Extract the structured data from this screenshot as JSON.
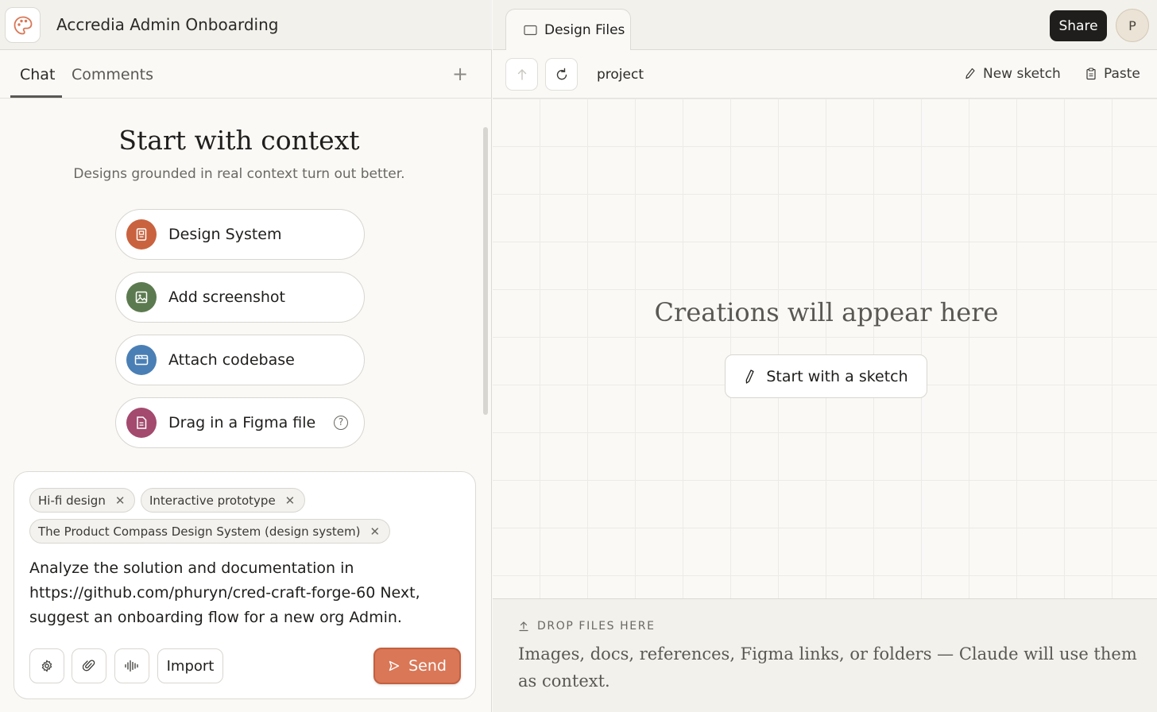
{
  "app": {
    "title": "Accredia Admin Onboarding"
  },
  "left_tabs": {
    "chat": "Chat",
    "comments": "Comments",
    "add": "+"
  },
  "context": {
    "heading": "Start with context",
    "subheading": "Designs grounded in real context turn out better.",
    "options": [
      {
        "label": "Design System",
        "icon": "design-system-icon",
        "color": "#c9623f"
      },
      {
        "label": "Add screenshot",
        "icon": "image-icon",
        "color": "#5c7a4f"
      },
      {
        "label": "Attach codebase",
        "icon": "folder-code-icon",
        "color": "#4a7fb5"
      },
      {
        "label": "Drag in a Figma file",
        "icon": "figma-file-icon",
        "color": "#a34a6e",
        "help": "?"
      }
    ]
  },
  "composer": {
    "chips": [
      "Hi-fi design",
      "Interactive prototype",
      "The Product Compass Design System (design system)"
    ],
    "chip_remove": "✕",
    "prompt": "Analyze the solution and documentation in https://github.com/phuryn/cred-craft-forge-60 Next, suggest an onboarding flow for a new org Admin.",
    "import_label": "Import",
    "send_label": "Send"
  },
  "right": {
    "file_tab": "Design Files",
    "share_label": "Share",
    "avatar_initial": "P",
    "breadcrumb": "project",
    "new_sketch": "New sketch",
    "paste": "Paste",
    "empty_title": "Creations will appear here",
    "sketch_button": "Start with a sketch",
    "drop_label": "DROP FILES HERE",
    "drop_text": "Images, docs, references, Figma links, or folders — Claude will use them as context."
  },
  "colors": {
    "accent": "#d97757",
    "dark": "#1f1e1c"
  }
}
